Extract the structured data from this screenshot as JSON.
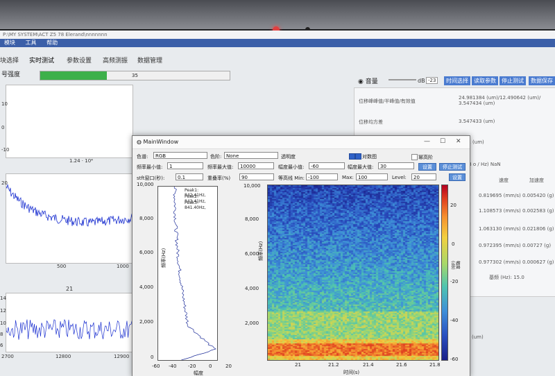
{
  "window_titlebar": "P:\\MY SYSTEM\\ACT Z5 78 Elerand\\nnnnnnn",
  "menu": [
    "模块",
    "工具",
    "帮助"
  ],
  "tabs": [
    "块选择",
    "实时测试",
    "参数设置",
    "高频测振",
    "数据管理"
  ],
  "strength_label": "号强度",
  "signal_strength": 35,
  "top_plot": {
    "y_ticks": [
      "10",
      "0",
      "-10"
    ],
    "x_label": "1.24 · 10⁴"
  },
  "middle_plot": {
    "y_tick": "20",
    "x_ticks": [
      "500",
      "1000"
    ]
  },
  "bottom_plot": {
    "title": "21",
    "y_ticks": [
      "14",
      "12",
      "10",
      "8",
      "6"
    ],
    "x_ticks": [
      "2700",
      "12800",
      "12900"
    ]
  },
  "volume": {
    "label": "音量",
    "unit": "dB",
    "value": "-23"
  },
  "action_buttons": [
    "时间选择",
    "读取参数",
    "停止测试",
    "数据保存"
  ],
  "readouts": [
    {
      "label": "位移峰峰值/半峰值/有效值",
      "value": "24.981384 (um)/12.490642 (um)/ 3.547434 (um)"
    },
    {
      "label": "位移均方差",
      "value": "3.547433 (um)"
    }
  ],
  "readout_partial": "2261 (um)",
  "readout_partial2": "0 (dB o / Hz) NaN",
  "table_headers": [
    "速度",
    "加速度"
  ],
  "table_rows": [
    {
      "vel": "0.819695 (mm/s)",
      "acc": "0.005420 (g)"
    },
    {
      "vel": "1.108573 (mm/s)",
      "acc": "0.002583 (g)"
    },
    {
      "vel": "1.063130 (mm/s)",
      "acc": "0.021806 (g)"
    },
    {
      "vel": "0.972395 (mm/s)",
      "acc": "0.00727 (g)"
    },
    {
      "vel": "0.977302 (mm/s)",
      "acc": "0.000627 (g)"
    }
  ],
  "base_freq": "基频 (Hz): 15.0",
  "bottom_right_unit": "(um)",
  "main_window": {
    "title": "MainWindow",
    "colormap_label": "色谱:",
    "colormap": "RGB",
    "color2_label": "色阶:",
    "color2": "None",
    "opacity_label": "透明度",
    "checkbox_label": "对数图",
    "checkbox2_label": "幂高阶",
    "freq_min_label": "频率最小值:",
    "freq_min": "1",
    "freq_max_label": "频率最大值:",
    "freq_max": "10000",
    "amp_min_label": "幅度最小值:",
    "amp_min": "-60",
    "amp_max_label": "幅度最大值:",
    "amp_max": "30",
    "confirm_btn": "设置",
    "stop_btn": "停止测试",
    "stft_label": "stft窗口(秒):",
    "stft": "0.1",
    "overlap_label": "重叠率(%)",
    "overlap": "90",
    "eq_min_label": "等高线 Min:",
    "eq_min": "-100",
    "eq_max_label": "Max:",
    "eq_max": "100",
    "level_label": "Level:",
    "level": "20",
    "apply_btn": "设置",
    "peaks": [
      "Peak1: 842.41Hz,",
      "Peak2: 843.41Hz,",
      "Peak3: 841.40Hz,"
    ],
    "left_y_ticks": [
      "10,000",
      "8,000",
      "6,000",
      "4,000",
      "2,000",
      "0"
    ],
    "left_x_ticks": [
      "-60",
      "-40",
      "-20",
      "0",
      "20"
    ],
    "left_xlabel": "幅度",
    "left_ylabel": "频率(Hz)",
    "spec_y_ticks": [
      "10,000",
      "8,000",
      "6,000",
      "4,000",
      "2,000"
    ],
    "spec_x_ticks": [
      "21",
      "21.2",
      "21.4",
      "21.6",
      "21.8"
    ],
    "spec_xlabel": "时间(s)",
    "spec_ylabel": "频率(Hz)",
    "cbar_ticks": [
      "20",
      "0",
      "-20",
      "-40",
      "-60"
    ],
    "cbar_label": "幅度(dB)"
  }
}
